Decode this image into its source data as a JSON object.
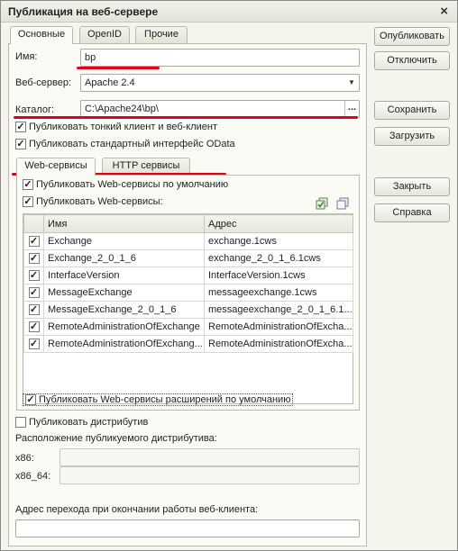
{
  "window": {
    "title": "Публикация на веб-сервере",
    "close": "×"
  },
  "tabs": [
    {
      "label": "Основные"
    },
    {
      "label": "OpenID"
    },
    {
      "label": "Прочие"
    }
  ],
  "form": {
    "name_label": "Имя:",
    "name_value": "bp",
    "webserver_label": "Веб-сервер:",
    "webserver_value": "Apache 2.4",
    "catalog_label": "Каталог:",
    "catalog_value": "C:\\Apache24\\bp\\",
    "catalog_button": "...",
    "thin_client": {
      "label": "Публиковать тонкий клиент и веб-клиент",
      "checked": true
    },
    "odata": {
      "label": "Публиковать стандартный интерфейс OData",
      "checked": true
    }
  },
  "service_tabs": [
    {
      "label": "Web-сервисы"
    },
    {
      "label": "HTTP сервисы"
    }
  ],
  "webservices": {
    "default_publish": {
      "label": "Публиковать Web-сервисы по умолчанию",
      "checked": true
    },
    "publish": {
      "label": "Публиковать Web-сервисы:",
      "checked": true
    },
    "columns": {
      "name": "Имя",
      "address": "Адрес"
    },
    "rows": [
      {
        "name": "Exchange",
        "address": "exchange.1cws",
        "checked": true
      },
      {
        "name": "Exchange_2_0_1_6",
        "address": "exchange_2_0_1_6.1cws",
        "checked": true
      },
      {
        "name": "InterfaceVersion",
        "address": "InterfaceVersion.1cws",
        "checked": true
      },
      {
        "name": "MessageExchange",
        "address": "messageexchange.1cws",
        "checked": true
      },
      {
        "name": "MessageExchange_2_0_1_6",
        "address": "messageexchange_2_0_1_6.1...",
        "checked": true
      },
      {
        "name": "RemoteAdministrationOfExchange",
        "address": "RemoteAdministrationOfExcha...",
        "checked": true
      },
      {
        "name": "RemoteAdministrationOfExchang...",
        "address": "RemoteAdministrationOfExcha...",
        "checked": true
      }
    ],
    "extensions_publish": {
      "label": "Публиковать Web-сервисы расширений по умолчанию",
      "checked": true
    }
  },
  "distributive": {
    "publish": {
      "label": "Публиковать дистрибутив",
      "checked": false
    },
    "location_label": "Расположение публикуемого дистрибутива:",
    "x86_label": "x86:",
    "x86_value": "",
    "x86_64_label": "x86_64:",
    "x86_64_value": ""
  },
  "redirect": {
    "label": "Адрес перехода при окончании работы веб-клиента:",
    "value": ""
  },
  "buttons": {
    "publish": "Опубликовать",
    "disable": "Отключить",
    "save": "Сохранить",
    "load": "Загрузить",
    "close": "Закрыть",
    "help": "Справка"
  },
  "check_glyph": "✓",
  "accent_color": "#e0001b"
}
